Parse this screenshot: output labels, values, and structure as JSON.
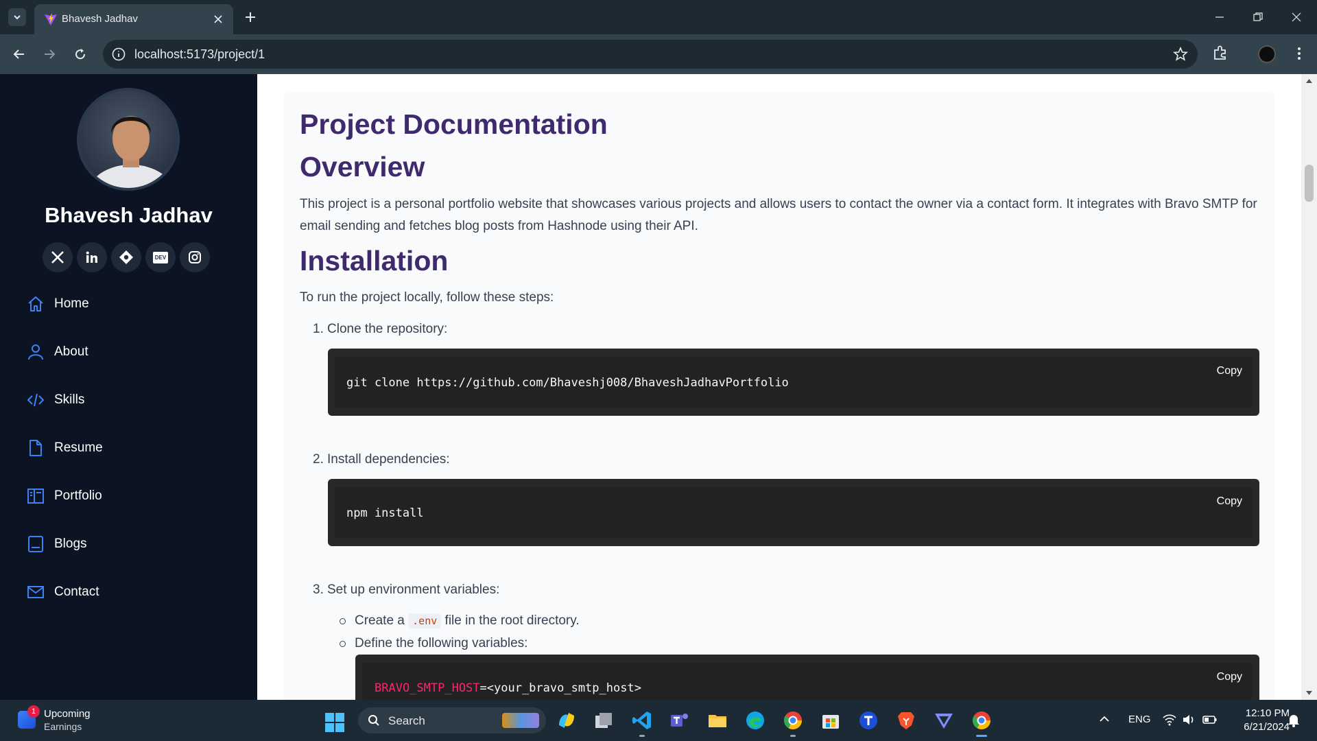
{
  "browser": {
    "tab_title": "Bhavesh Jadhav",
    "url": "localhost:5173/project/1"
  },
  "sidebar": {
    "name": "Bhavesh Jadhav",
    "socials": [
      "x-icon",
      "linkedin-icon",
      "hashnode-icon",
      "dev-icon",
      "instagram-icon"
    ],
    "dev_label": "DEV",
    "nav": [
      {
        "label": "Home",
        "icon": "home-icon"
      },
      {
        "label": "About",
        "icon": "user-icon"
      },
      {
        "label": "Skills",
        "icon": "code-icon"
      },
      {
        "label": "Resume",
        "icon": "document-icon"
      },
      {
        "label": "Portfolio",
        "icon": "portfolio-icon"
      },
      {
        "label": "Blogs",
        "icon": "blog-icon"
      },
      {
        "label": "Contact",
        "icon": "mail-icon"
      }
    ],
    "accent_color": "#3b82f6"
  },
  "doc": {
    "title": "Project Documentation",
    "overview_heading": "Overview",
    "overview_text": "This project is a personal portfolio website that showcases various projects and allows users to contact the owner via a contact form. It integrates with Bravo SMTP for email sending and fetches blog posts from Hashnode using their API.",
    "installation_heading": "Installation",
    "installation_intro": "To run the project locally, follow these steps:",
    "steps": [
      {
        "number": "1.",
        "text": "Clone the repository:",
        "code": "git clone https://github.com/Bhaveshj008/BhaveshJadhavPortfolio"
      },
      {
        "number": "2.",
        "text": "Install dependencies:",
        "code": "npm install"
      },
      {
        "number": "3.",
        "text": "Set up environment variables:"
      }
    ],
    "env_sub": {
      "create_prefix": "Create a ",
      "create_code": ".env",
      "create_suffix": " file in the root directory.",
      "define": "Define the following variables:"
    },
    "env_code_key": "BRAVO_SMTP_HOST",
    "env_code_value": "=<your_bravo_smtp_host>",
    "copy_label": "Copy",
    "heading_color": "#3f2a6e"
  },
  "taskbar": {
    "widget_title": "Upcoming",
    "widget_sub": "Earnings",
    "widget_badge": "1",
    "search_label": "Search",
    "language": "ENG",
    "time": "12:10 PM",
    "date": "6/21/2024"
  }
}
